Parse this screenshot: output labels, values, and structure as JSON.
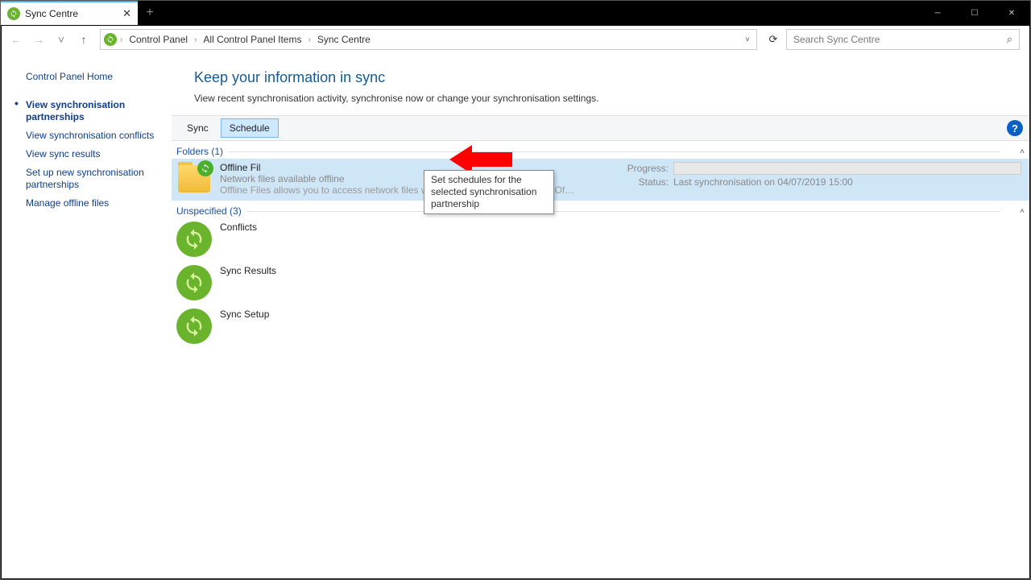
{
  "tab_title": "Sync Centre",
  "breadcrumbs": [
    "Control Panel",
    "All Control Panel Items",
    "Sync Centre"
  ],
  "search_placeholder": "Search Sync Centre",
  "sidebar": {
    "home": "Control Panel Home",
    "items": [
      "View synchronisation partnerships",
      "View synchronisation conflicts",
      "View sync results",
      "Set up new synchronisation partnerships",
      "Manage offline files"
    ]
  },
  "heading": "Keep your information in sync",
  "sub": "View recent synchronisation activity, synchronise now or change your synchronisation settings.",
  "toolbar": {
    "sync": "Sync",
    "schedule": "Schedule"
  },
  "tooltip": "Set schedules for the selected synchronisation partnership",
  "group1": {
    "label": "Folders (1)"
  },
  "offline": {
    "title": "Offline Fil",
    "sub1": "Network files available offline",
    "sub2": "Offline Files allows you to access network files while working offline. To set up Off...",
    "prog_label": "Progress:",
    "status_label": "Status:",
    "status_value": "Last synchronisation on 04/07/2019 15:00"
  },
  "group2": {
    "label": "Unspecified (3)"
  },
  "items": [
    {
      "title": "Conflicts"
    },
    {
      "title": "Sync Results"
    },
    {
      "title": "Sync Setup"
    }
  ]
}
